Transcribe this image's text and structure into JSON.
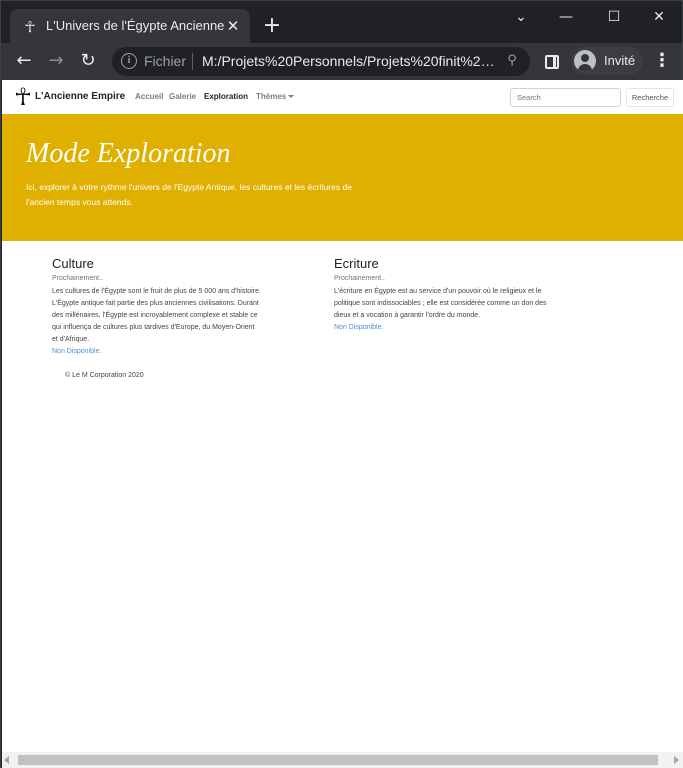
{
  "browser": {
    "tab": {
      "title": "L'Univers de l'Égypte Ancienne",
      "favicon": "ankh-icon",
      "close_glyph": "✕"
    },
    "new_tab_glyph": "+",
    "window_controls": {
      "minimize": "—",
      "maximize": "☐",
      "close": "✕",
      "tab_search": "⌄"
    },
    "toolbar": {
      "back": "←",
      "forward": "→",
      "reload": "↻",
      "info_glyph": "i",
      "scheme_label": "Fichier",
      "url": "M:/Projets%20Personnels/Projets%20finit%20...",
      "zoom_glyph": "⚲",
      "profile_label": "Invité",
      "menu_glyph": "⋮"
    }
  },
  "site": {
    "nav": {
      "brand_icon": "☥",
      "brand": "L'Ancienne Empire",
      "links": [
        "Accueil",
        "Galerie",
        "Exploration",
        "Thèmes"
      ],
      "active_link": "Exploration",
      "search_placeholder": "Search",
      "search_button": "Recherche"
    },
    "jumbotron": {
      "title": "Mode Exploration",
      "lead": "Ici, explorer à votre rythme l'univers de l'Egypte Antique, les cultures et les écritures de l'ancien temps vous attends.",
      "background_color": "#e0b000"
    },
    "sections": [
      {
        "title": "Culture",
        "subtitle": "Prochainement..",
        "text": "Les cultures de l'Égypte sont le fruit de plus de 5 000 ans d'histoire. L'Égypte antique fait partie des plus anciennes civilisations. Durant des millénaires, l'Égypte est incroyablement complexe et stable ce qui influença de cultures plus tardives d'Europe, du Moyen-Orient et d'Afrique.",
        "link": "Non Disponible."
      },
      {
        "title": "Ecriture",
        "subtitle": "Prochainement..",
        "text": "L'écriture en Égypte est au service d'un pouvoir où le religieux et le politique sont indissociables ; elle est considérée comme un don des dieux et a vocation à garantir l'ordre du monde.",
        "link": "Non Disponible."
      }
    ],
    "footer": "© Le M Corporation 2020"
  }
}
